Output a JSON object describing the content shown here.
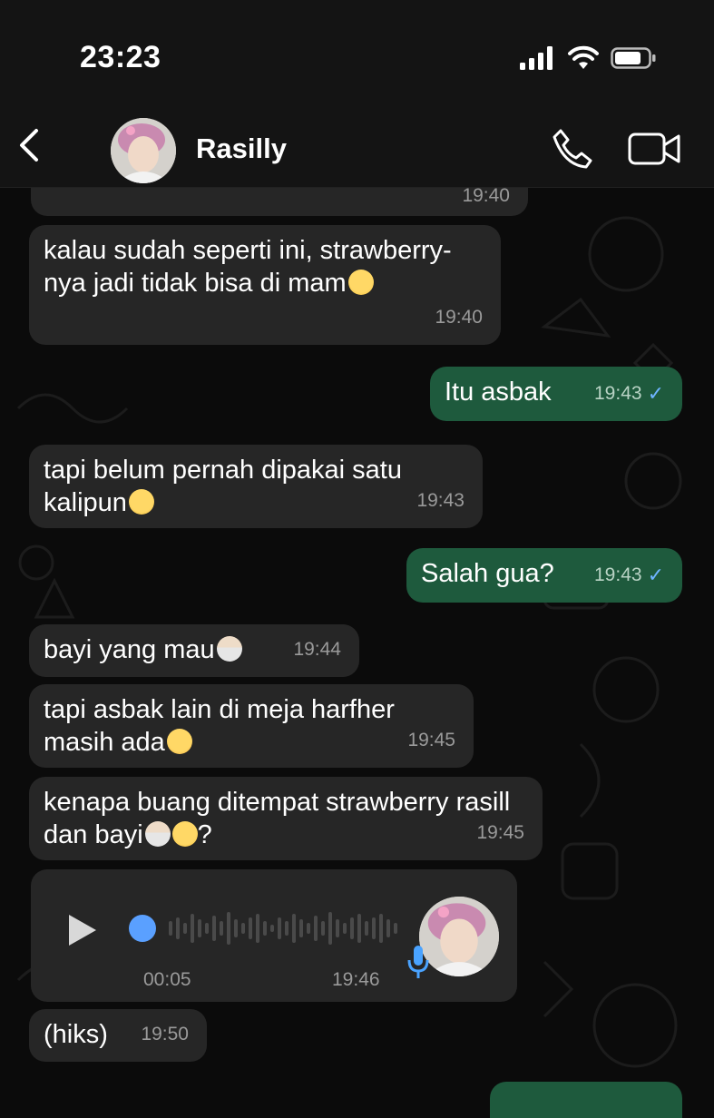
{
  "status_bar": {
    "time": "23:23"
  },
  "header": {
    "contact_name": "Rasilly"
  },
  "messages": [
    {
      "direction": "in",
      "text": "kalau sudah seperti ini, strawberry-nya jadi tidak bisa di mam",
      "emoji": "pleading-face",
      "time": "19:40"
    },
    {
      "direction": "out",
      "text": "Itu asbak",
      "time": "19:43",
      "status": "✓"
    },
    {
      "direction": "in",
      "text": "tapi belum pernah dipakai satu kalipun",
      "emoji": "pleading-face",
      "time": "19:43"
    },
    {
      "direction": "out",
      "text": "Salah gua?",
      "time": "19:43",
      "status": "✓"
    },
    {
      "direction": "in",
      "text": "bayi yang mau",
      "emoji": "person-emoji",
      "time": "19:44"
    },
    {
      "direction": "in",
      "text": "tapi asbak lain di meja harfher masih ada",
      "emoji": "confounded-face",
      "time": "19:45"
    },
    {
      "direction": "in",
      "text_before": "kenapa buang ditempat strawberry rasill dan bayi",
      "text_after": "?",
      "emoji": [
        "person-emoji",
        "pleading-face"
      ],
      "time": "19:45"
    },
    {
      "direction": "in",
      "text": "(hiks)",
      "time": "19:50"
    }
  ],
  "earlier_message": {
    "time": "19:40"
  },
  "voice_message": {
    "duration": "00:05",
    "time": "19:46"
  },
  "colors": {
    "incoming_bubble": "#262626",
    "outgoing_bubble": "#1e5a3d",
    "accent": "#5aa0ff"
  }
}
